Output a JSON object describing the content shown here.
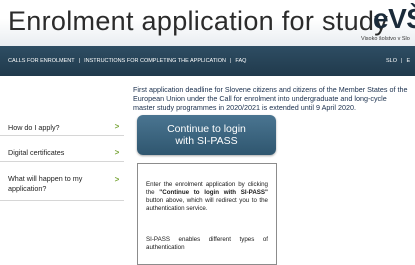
{
  "header": {
    "title": "Enrolment application for study",
    "logo_text": "eVŠ",
    "logo_subtitle": "Visoko šolstvo v Slo"
  },
  "nav": {
    "items": [
      "CALLS FOR ENROLMENT",
      "INSTRUCTIONS FOR COMPLETING THE APPLICATION",
      "FAQ"
    ],
    "separator": "|",
    "language_current": "SLO",
    "language_other": "E"
  },
  "notice": {
    "text": "First application deadline for Slovene citizens and citizens of the Member States of the European Union under the Call for enrolment into undergraduate and long-cycle master study programmes in 2020/2021 is extended until 9 April 2020."
  },
  "sidebar": {
    "items": [
      {
        "label": "How do I apply?",
        "icon": "chevron-right-icon",
        "glyph": ">"
      },
      {
        "label": "Digital certificates",
        "icon": "chevron-right-icon",
        "glyph": ">"
      },
      {
        "label": "What will happen to my application?",
        "icon": "chevron-right-icon",
        "glyph": ">"
      }
    ]
  },
  "login_button": {
    "line1": "Continue to login",
    "line2": "with SI-PASS"
  },
  "info_box": {
    "p1_before": "Enter the enrolment application by clicking the ",
    "p1_bold": "\"Continue to login with SI-PASS\"",
    "p1_after": " button above, which will redirect you to the authentication service.",
    "p2": "SI-PASS enables different types of authentication"
  },
  "colors": {
    "navbar": "#203a4c",
    "button": "#3a6580",
    "notice_text": "#1a2f4d",
    "chevron": "#7aa63a"
  }
}
